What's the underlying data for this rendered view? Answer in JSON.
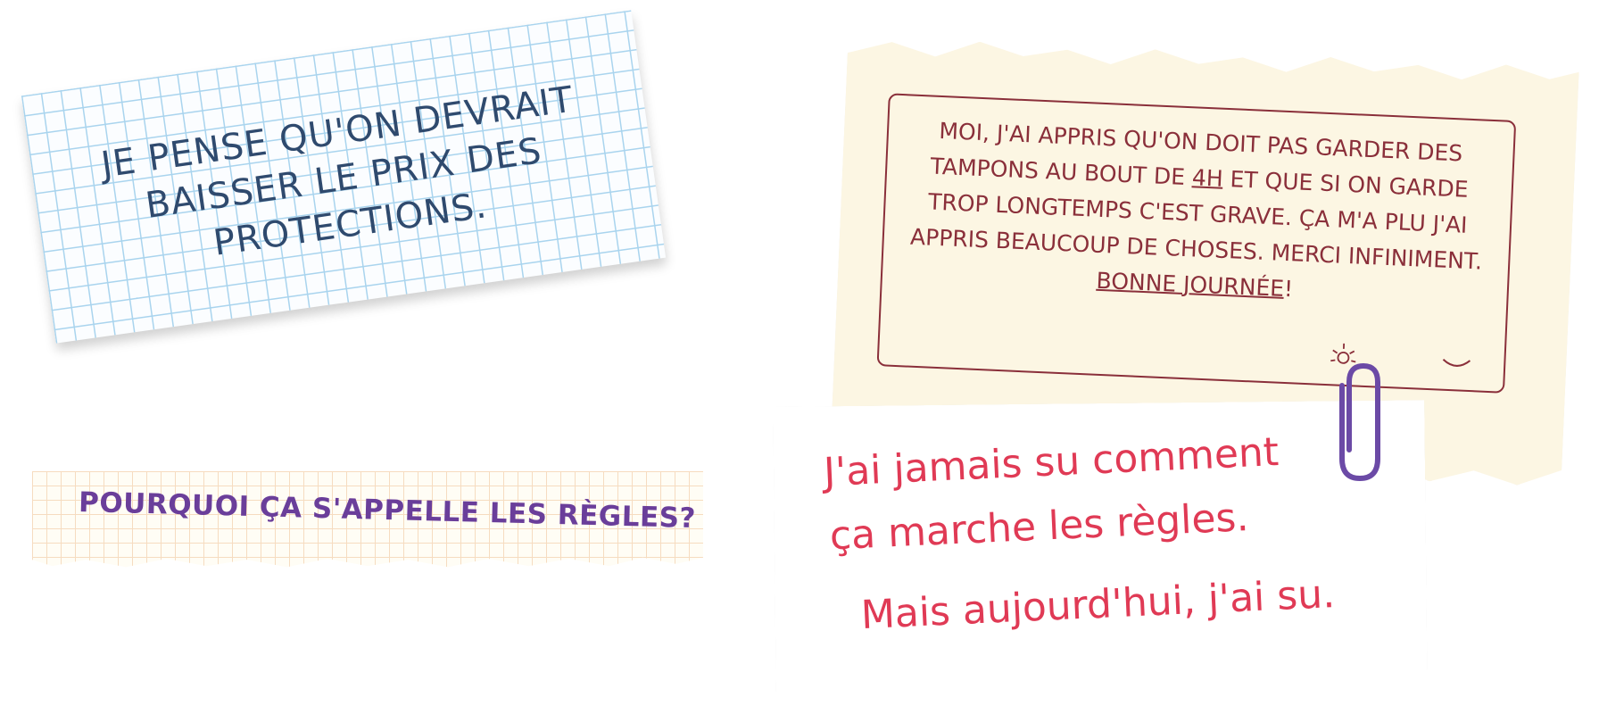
{
  "notes": {
    "grid_note": {
      "lines": [
        "JE PENSE QU'ON DEVRAIT",
        "BAISSER LE PRIX DES",
        "PROTECTIONS."
      ],
      "text_color": "#2f4a6e",
      "grid_color": "#a9d4ee"
    },
    "strip_note": {
      "text": "POURQUOI ÇA S'APPELLE LES RÈGLES?",
      "text_color": "#6a3e9a"
    },
    "cream_note": {
      "line1": "Moi, j'ai appris qu'on doit pas garder des",
      "line2_a": "tampons au bout de ",
      "line2_emph": "4h",
      "line2_b": " et que si on garde",
      "line3": "trop longtemps c'est grave. Ça m'a plu j'ai",
      "line4": "appris beaucoup de choses. Merci infiniment.",
      "closing": "Bonne journée",
      "closing_punct": "!",
      "text_color": "#8a2f3a",
      "paper_color": "#fcf6e3"
    },
    "white_note": {
      "lines": [
        "J'ai jamais su comment",
        "ça marche les règles.",
        "Mais aujourd'hui, j'ai su."
      ],
      "text_color": "#e03a55",
      "clip_color": "#6b4aa6",
      "clip_icon": "paperclip-icon"
    }
  }
}
